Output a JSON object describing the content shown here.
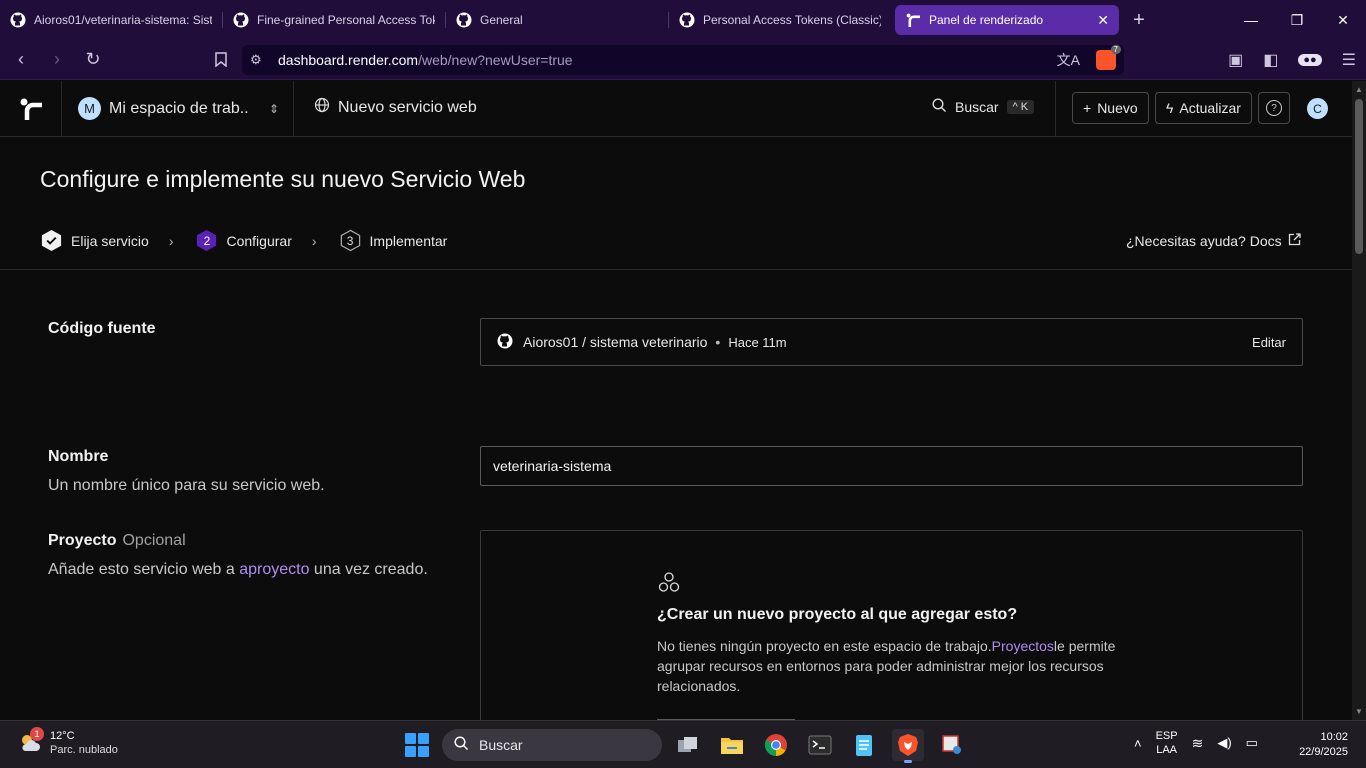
{
  "browser": {
    "tabs": [
      {
        "label": "Aioros01/veterinaria-sistema: Siste",
        "icon": "github-icon"
      },
      {
        "label": "Fine-grained Personal Access Toke",
        "icon": "github-icon"
      },
      {
        "label": "General",
        "icon": "github-icon"
      },
      {
        "label": "Personal Access Tokens (Classic)",
        "icon": "github-icon"
      },
      {
        "label": "Panel de renderizado",
        "icon": "render-icon"
      }
    ],
    "url_host": "dashboard.render.com",
    "url_path": "/web/new?newUser=true",
    "shield_count": "7"
  },
  "header": {
    "workspace_initial": "M",
    "workspace_name": "Mi espacio de trab...",
    "breadcrumb": "Nuevo servicio web",
    "search_label": "Buscar",
    "search_shortcut": "K",
    "new_label": "Nuevo",
    "upgrade_label": "Actualizar",
    "user_initial": "C"
  },
  "page": {
    "title": "Configure e implemente su nuevo Servicio Web",
    "steps": [
      {
        "label": "Elija servicio",
        "num": ""
      },
      {
        "label": "Configurar",
        "num": "2"
      },
      {
        "label": "Implementar",
        "num": "3"
      }
    ],
    "help_link": "¿Necesitas ayuda? Docs"
  },
  "source": {
    "label": "Código fuente",
    "repo": "Aioros01 / sistema veterinario",
    "ago": "Hace 11m",
    "edit": "Editar"
  },
  "name": {
    "label": "Nombre",
    "description": "Un nombre único para su servicio web.",
    "value": "veterinaria-sistema"
  },
  "project": {
    "label": "Proyecto",
    "optional": "Opcional",
    "desc_before": "Añade esto servicio web a ",
    "desc_link": "aproyecto",
    "desc_after": " una vez creado.",
    "card_title": "¿Crear un nuevo proyecto al que agregar esto?",
    "card_text_before": "No tienes ningún proyecto en este espacio de trabajo.",
    "card_text_link": "Proyectos",
    "card_text_after": "le permite agrupar recursos en entornos para poder administrar mejor los recursos relacionados."
  },
  "taskbar": {
    "weather_temp": "12°C",
    "weather_desc": "Parc. nublado",
    "weather_badge": "1",
    "search_label": "Buscar",
    "lang_top": "ESP",
    "lang_bottom": "LAA",
    "time": "10:02",
    "date": "22/9/2025"
  },
  "colors": {
    "browser_chrome": "#200d3a",
    "active_tab": "#5b2ca8",
    "link": "#b18cf2",
    "step_active": "#5b21b6"
  }
}
